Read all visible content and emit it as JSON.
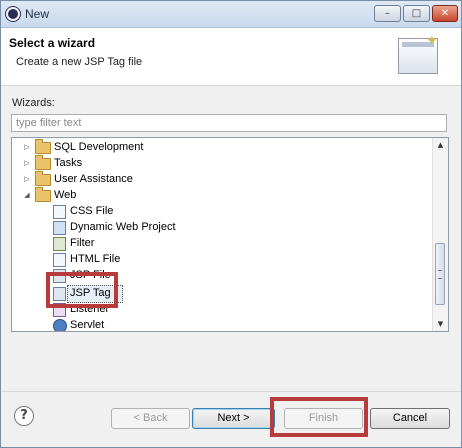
{
  "window": {
    "title": "New"
  },
  "banner": {
    "title": "Select a wizard",
    "description": "Create a new JSP Tag file"
  },
  "wizards": {
    "label": "Wizards:",
    "filter_placeholder": "type filter text",
    "tree": {
      "folders": [
        {
          "label": "SQL Development",
          "expanded": false
        },
        {
          "label": "Tasks",
          "expanded": false
        },
        {
          "label": "User Assistance",
          "expanded": false
        },
        {
          "label": "Web",
          "expanded": true
        }
      ],
      "web_children": [
        {
          "label": "CSS File",
          "icon": "css-file-icon"
        },
        {
          "label": "Dynamic Web Project",
          "icon": "web-project-icon"
        },
        {
          "label": "Filter",
          "icon": "filter-icon"
        },
        {
          "label": "HTML File",
          "icon": "html-file-icon"
        },
        {
          "label": "JSP File",
          "icon": "jsp-file-icon"
        },
        {
          "label": "JSP Tag",
          "icon": "jsp-tag-icon",
          "selected": true
        },
        {
          "label": "Listener",
          "icon": "listener-icon"
        },
        {
          "label": "Servlet",
          "icon": "servlet-icon"
        }
      ]
    }
  },
  "buttons": {
    "help": "?",
    "back": "< Back",
    "next": "Next >",
    "finish": "Finish",
    "cancel": "Cancel"
  },
  "colors": {
    "highlight": "#b73b3b"
  }
}
